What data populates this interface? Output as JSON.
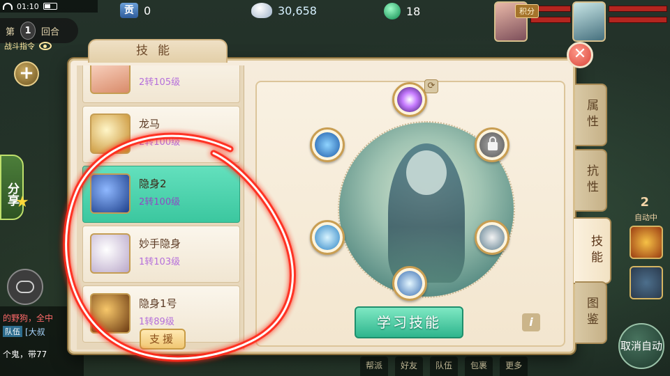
{
  "status_bar": {
    "time": "01:10"
  },
  "round": {
    "prefix": "第",
    "number": "1",
    "suffix": "回合"
  },
  "battle_command": "战斗指令",
  "currencies": {
    "contribution": {
      "icon_text": "贡",
      "value": "0"
    },
    "silver": {
      "value": "30,658"
    },
    "jade": {
      "value": "18"
    }
  },
  "top_right": {
    "score_label": "积分"
  },
  "share": {
    "label": "分享"
  },
  "chat": {
    "line1": "的野狗，全中",
    "team_tag": "队伍",
    "team_text": "[大叔",
    "line3": "个鬼，带77"
  },
  "auto": {
    "number": "2",
    "label": "自动中",
    "cancel_label": "取消自动"
  },
  "bottom_menu": [
    "帮派",
    "好友",
    "队伍",
    "包裹",
    "更多"
  ],
  "dialog": {
    "title": "技能",
    "pets": [
      {
        "name": "",
        "level": "2转105级",
        "selected": false
      },
      {
        "name": "龙马",
        "level": "2转100级",
        "selected": false
      },
      {
        "name": "隐身2",
        "level": "2转100级",
        "selected": true
      },
      {
        "name": "妙手隐身",
        "level": "1转103级",
        "selected": false
      },
      {
        "name": "隐身1号",
        "level": "1转89级",
        "selected": false
      }
    ],
    "assist_label": "支援",
    "learn_label": "学习技能",
    "info_label": "i",
    "refresh_label": "⟳",
    "close_label": "✕",
    "side_tabs": [
      {
        "label": "属性",
        "active": false
      },
      {
        "label": "抗性",
        "active": false
      },
      {
        "label": "技能",
        "active": true
      },
      {
        "label": "图鉴",
        "active": false
      }
    ]
  },
  "colors": {
    "selected_card": "#3bc79f",
    "level_text": "#b56fdb",
    "learn_button": "#2fb58d",
    "annotation": "#ff2a1a"
  }
}
